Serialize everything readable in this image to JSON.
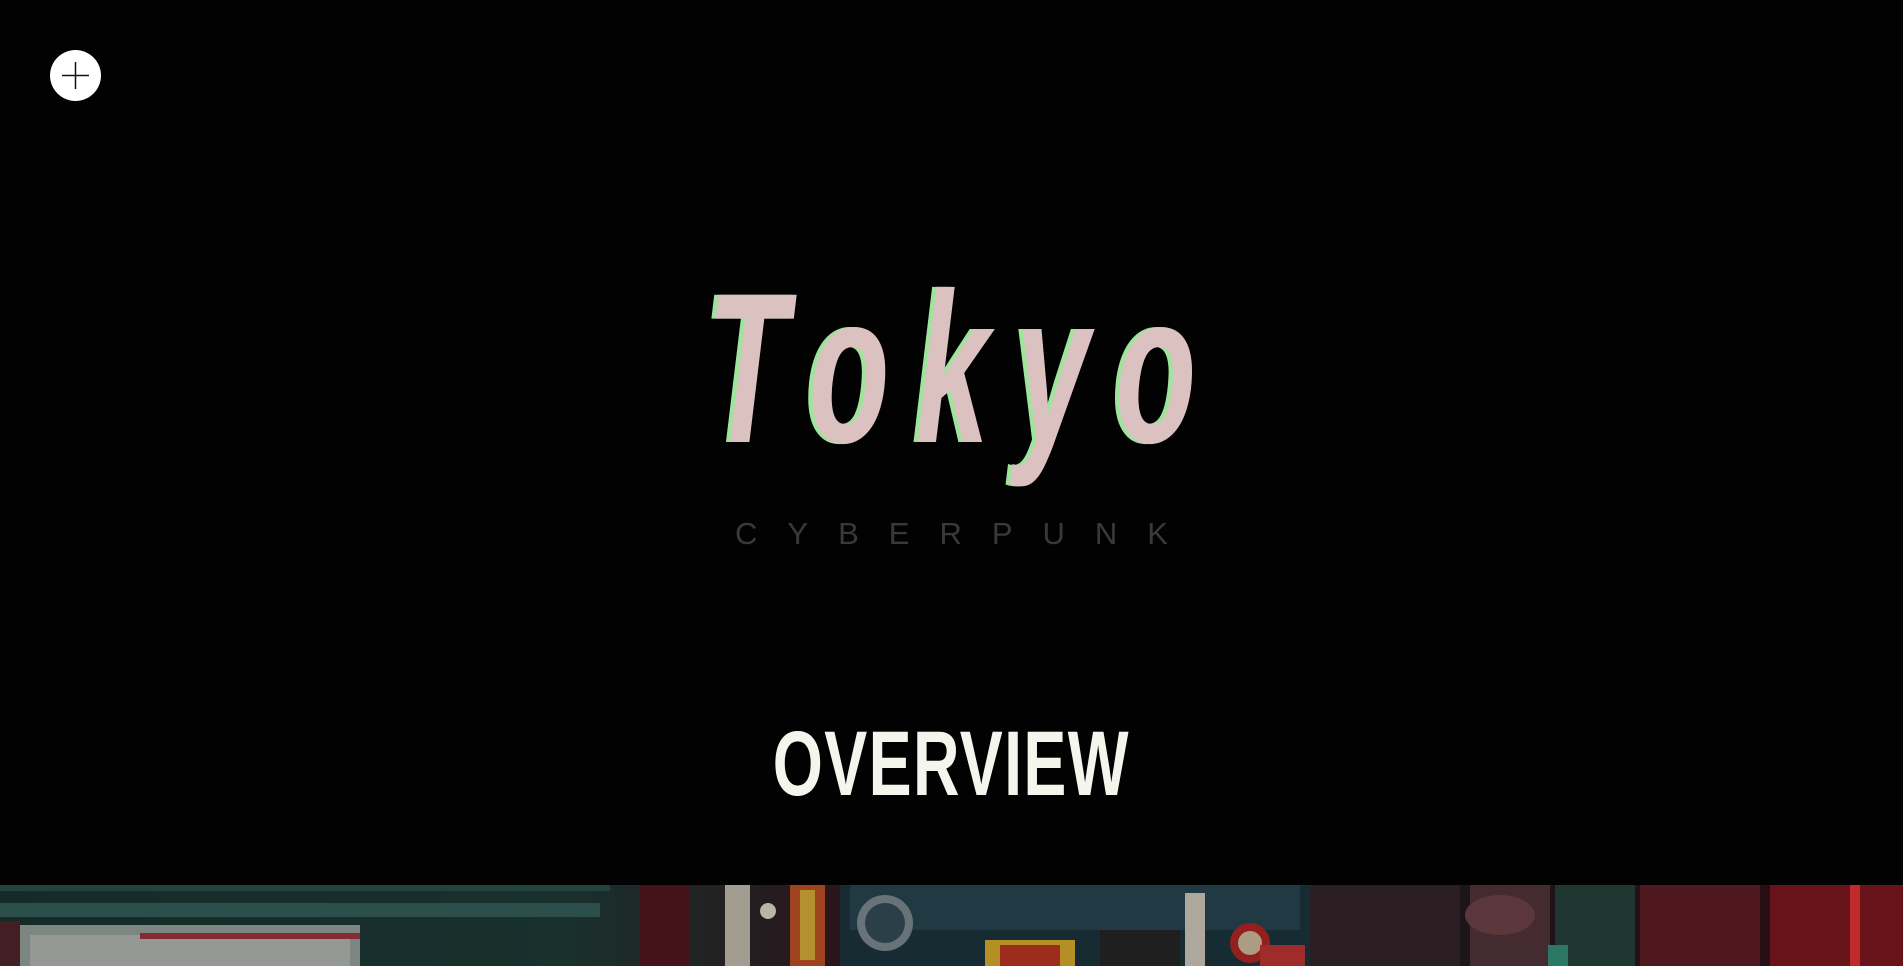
{
  "menu": {
    "icon": "plus-icon"
  },
  "hero": {
    "title": "Tokyo",
    "subtitle": "CYBERPUNK"
  },
  "overview": {
    "heading": "OVERVIEW"
  },
  "colors": {
    "background": "#020202",
    "title_fill": "#dcc1c1",
    "title_shadow": "#9ee49c",
    "subtitle": "#3d3838",
    "heading": "#f4f5ec"
  }
}
